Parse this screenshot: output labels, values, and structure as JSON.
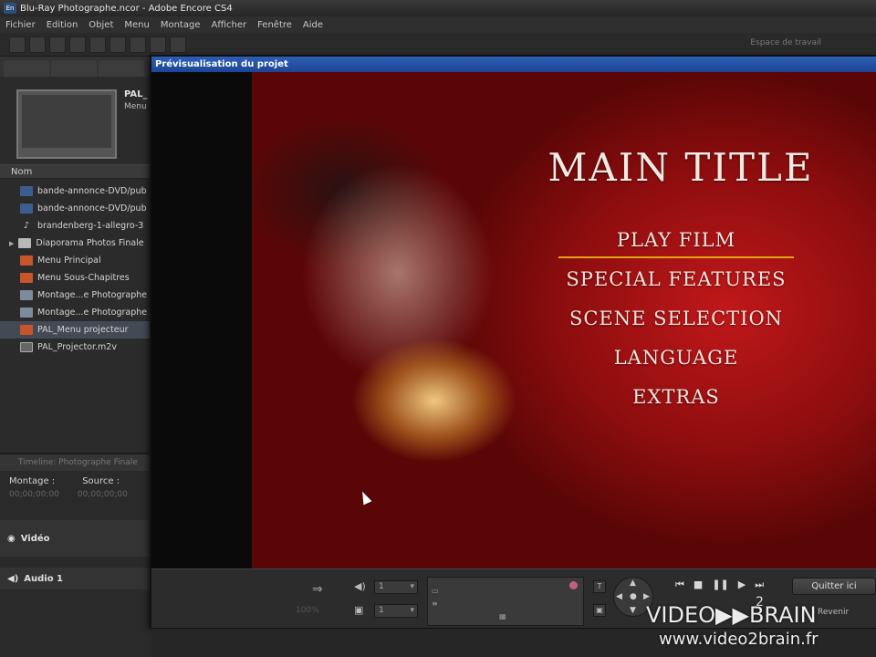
{
  "app": {
    "logo_text": "En",
    "title": "Blu-Ray Photographe.ncor - Adobe Encore CS4"
  },
  "menubar": [
    "Fichier",
    "Edition",
    "Objet",
    "Menu",
    "Montage",
    "Afficher",
    "Fenêtre",
    "Aide"
  ],
  "toolbar": {
    "workspace": "Espace de travail"
  },
  "project_panel": {
    "selected_asset": {
      "name": "PAL_",
      "type": "Menu"
    },
    "column_name": "Nom",
    "assets": [
      {
        "icon": "video-file-icon",
        "label": "bande-annonce-DVD/pub"
      },
      {
        "icon": "video-file-icon",
        "label": "bande-annonce-DVD/pub"
      },
      {
        "icon": "audio-file-icon",
        "label": "brandenberg-1-allegro-3"
      },
      {
        "icon": "folder-icon",
        "label": "Diaporama Photos Finale"
      },
      {
        "icon": "menu-file-icon",
        "label": "Menu Principal"
      },
      {
        "icon": "menu-file-icon",
        "label": "Menu Sous-Chapitres"
      },
      {
        "icon": "montage-icon",
        "label": "Montage...e Photographe"
      },
      {
        "icon": "montage-icon",
        "label": "Montage...e Photographe"
      },
      {
        "icon": "menu-file-icon",
        "label": "PAL_Menu projecteur"
      },
      {
        "icon": "m2v-file-icon",
        "label": "PAL_Projector.m2v"
      }
    ]
  },
  "timeline_panel": {
    "tab": "Timeline: Photographe Finale",
    "montage_label": "Montage :",
    "source_label": "Source :",
    "montage_tc": "00;00;00;00",
    "source_tc": "00;00;00;00",
    "video_track": "Vidéo",
    "audio_track": "Audio 1"
  },
  "preview": {
    "window_title": "Prévisualisation du projet",
    "menu_title": "MAIN TITLE",
    "menu_items": [
      "PLAY FILM",
      "SPECIAL FEATURES",
      "SCENE SELECTION",
      "LANGUAGE",
      "EXTRAS"
    ],
    "active_item_index": 0,
    "zoom": "100%",
    "audio_select": "1",
    "subtitle_select": "1",
    "page_number": "2",
    "quit_button": "Quitter ici",
    "return_label": "Revenir"
  },
  "watermark": {
    "brand": "VIDEO▶▶BRAIN",
    "url": "www.video2brain.fr"
  }
}
